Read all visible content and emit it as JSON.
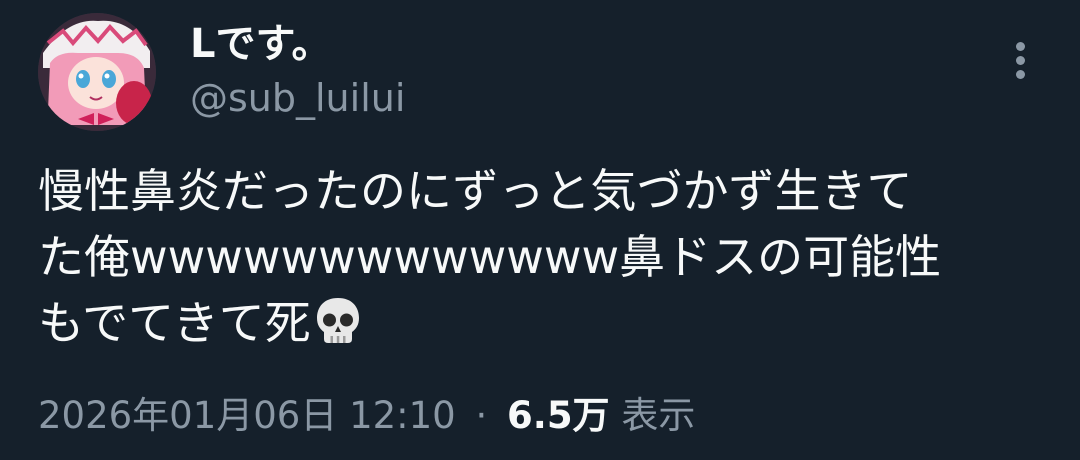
{
  "tweet": {
    "author": {
      "display_name": "Lです。",
      "handle": "@sub_luilui"
    },
    "text_lines": [
      "慢性鼻炎だったのにずっと気づかず生きて",
      "た俺wwwwwwwwwwwww鼻ドスの可能性",
      "もでてきて死"
    ],
    "emoji": "skull-icon",
    "timestamp": "2026年01月06日 12:10",
    "separator": "·",
    "views_count": "6.5万",
    "views_label": "表示"
  },
  "colors": {
    "background": "#15202b",
    "primary_text": "#f7f9f9",
    "secondary_text": "#8b98a5"
  }
}
